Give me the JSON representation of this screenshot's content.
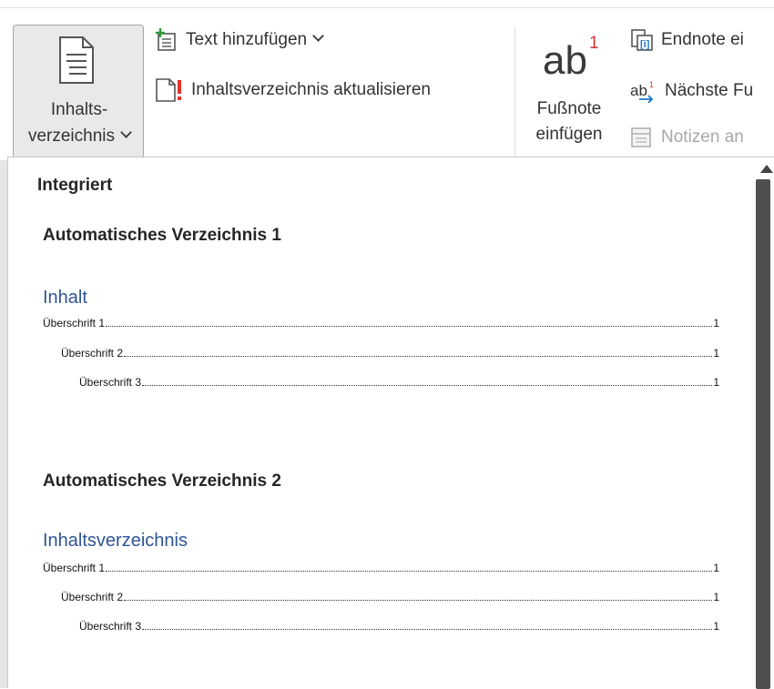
{
  "ribbon": {
    "toc_button": {
      "line1": "Inhalts-",
      "line2": "verzeichnis",
      "icon": "document-list-icon"
    },
    "add_text": {
      "label": "Text hinzufügen",
      "icon": "add-text-icon"
    },
    "update_toc": {
      "label": "Inhaltsverzeichnis aktualisieren",
      "icon": "update-table-icon"
    },
    "footnote": {
      "ab": "ab",
      "sup": "1",
      "line1": "Fußnote",
      "line2": "einfügen"
    },
    "endnote": {
      "label": "Endnote ei",
      "icon": "insert-endnote-icon"
    },
    "next_footnote": {
      "label": "Nächste Fu",
      "icon": "next-footnote-icon"
    },
    "notes": {
      "label": "Notizen an",
      "icon": "show-notes-icon",
      "disabled": true
    }
  },
  "gallery": {
    "category": "Integriert",
    "items": [
      {
        "title": "Automatisches Verzeichnis 1",
        "heading": "Inhalt",
        "entries": [
          {
            "text": "Überschrift 1",
            "page": "1",
            "level": 1
          },
          {
            "text": "Überschrift 2",
            "page": "1",
            "level": 2
          },
          {
            "text": "Überschrift 3",
            "page": "1",
            "level": 3
          }
        ]
      },
      {
        "title": "Automatisches Verzeichnis 2",
        "heading": "Inhaltsverzeichnis",
        "entries": [
          {
            "text": "Überschrift 1",
            "page": "1",
            "level": 1
          },
          {
            "text": "Überschrift 2",
            "page": "1",
            "level": 2
          },
          {
            "text": "Überschrift 3",
            "page": "1",
            "level": 3
          }
        ]
      }
    ]
  },
  "colors": {
    "accent_heading": "#2f5597",
    "footnote_number": "#d13438"
  }
}
